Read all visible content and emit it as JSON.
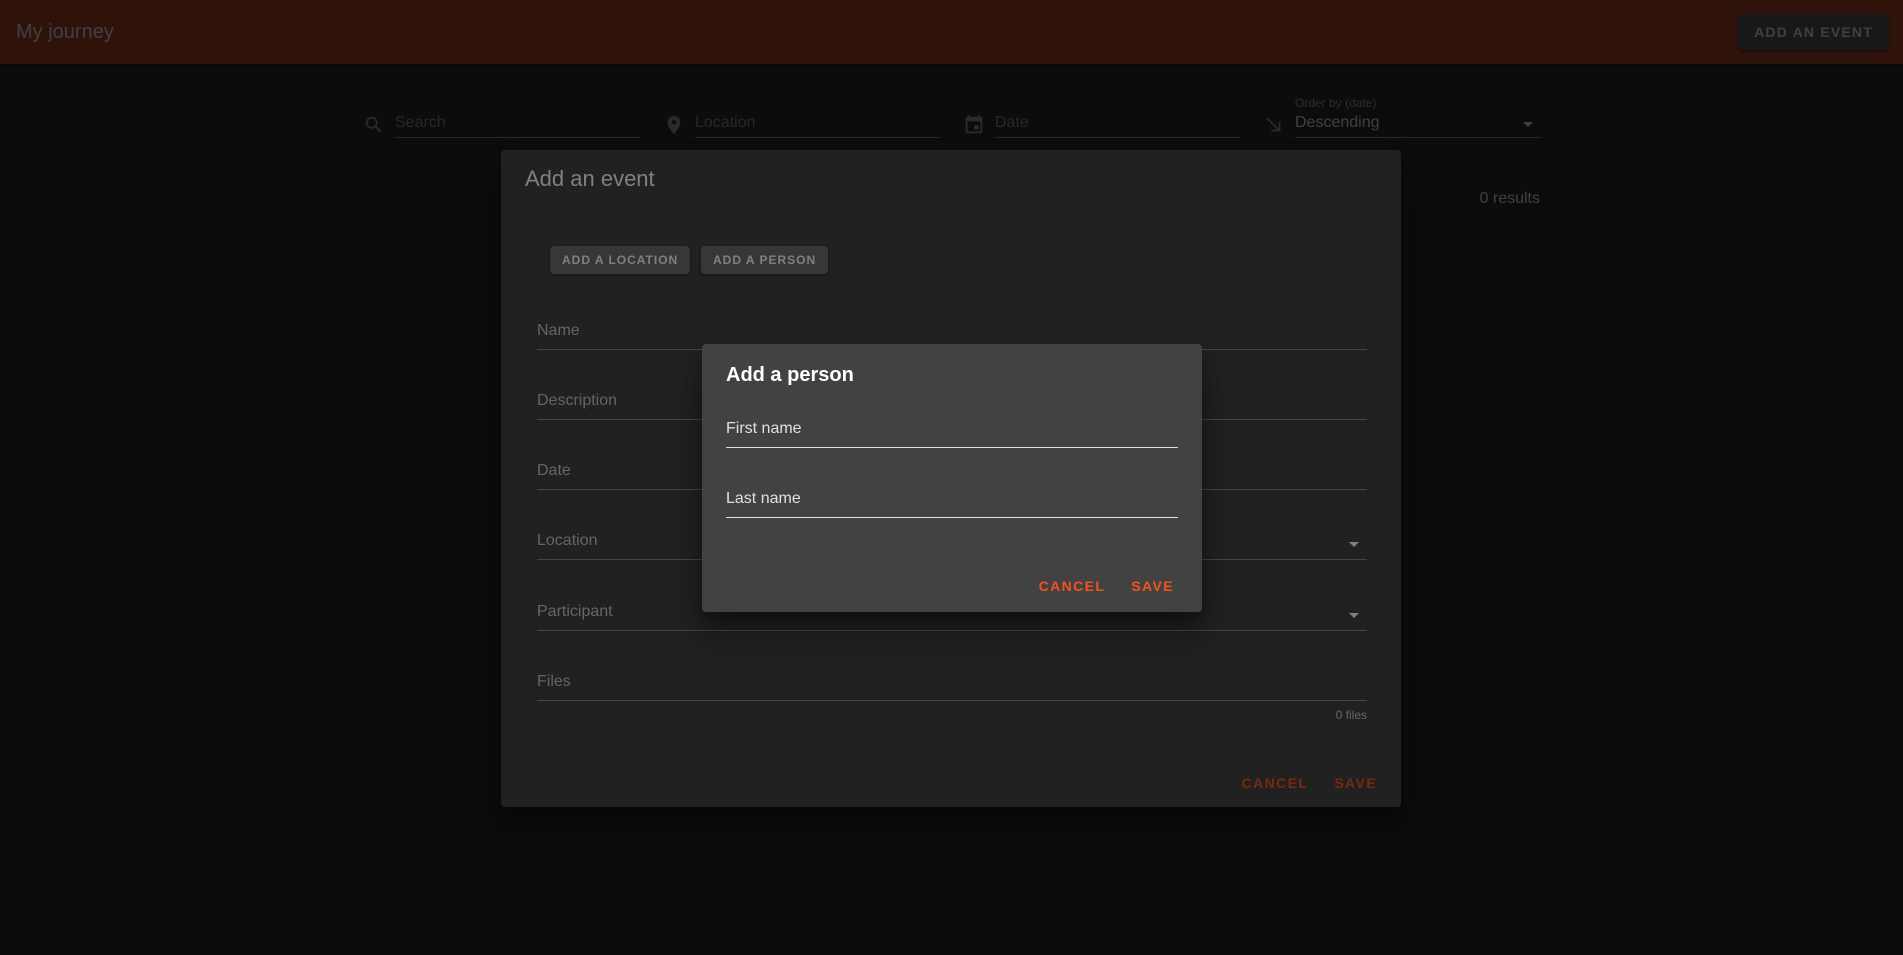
{
  "appbar": {
    "title": "My journey",
    "add_event_label": "ADD AN EVENT"
  },
  "filters": {
    "search_placeholder": "Search",
    "location_placeholder": "Location",
    "date_placeholder": "Date",
    "order_label": "Order by (date)",
    "order_value": "Descending"
  },
  "results_text": "0 results",
  "event_dialog": {
    "title": "Add an event",
    "add_location_label": "ADD A LOCATION",
    "add_person_label": "ADD A PERSON",
    "fields": {
      "name": "Name",
      "description": "Description",
      "date": "Date",
      "location": "Location",
      "participant": "Participant",
      "files": "Files"
    },
    "files_count": "0 files",
    "cancel_label": "CANCEL",
    "save_label": "SAVE"
  },
  "person_dialog": {
    "title": "Add a person",
    "first_name_label": "First name",
    "last_name_label": "Last name",
    "cancel_label": "CANCEL",
    "save_label": "SAVE"
  },
  "colors": {
    "appbar": "#bf4d2e",
    "accent": "#f4511e",
    "surface": "#424242",
    "background": "#303030"
  }
}
